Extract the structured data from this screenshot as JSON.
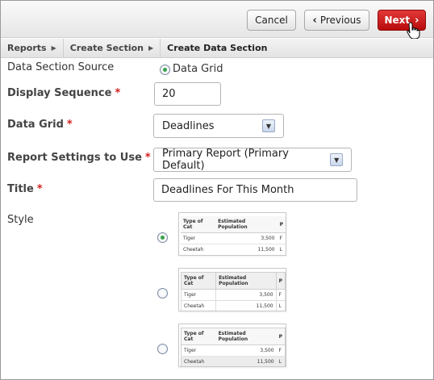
{
  "toolbar": {
    "cancel_label": "Cancel",
    "previous_label": "Previous",
    "next_label": "Next"
  },
  "breadcrumb": [
    "Reports",
    "Create Section",
    "Create Data Section"
  ],
  "form": {
    "data_section_source": {
      "label": "Data Section Source",
      "option": "Data Grid"
    },
    "display_sequence": {
      "label": "Display Sequence",
      "value": "20"
    },
    "data_grid": {
      "label": "Data Grid",
      "value": "Deadlines"
    },
    "report_settings": {
      "label": "Report Settings to Use",
      "value": "Primary Report (Primary Default)"
    },
    "title": {
      "label": "Title",
      "value": "Deadlines For This Month"
    },
    "style": {
      "label": "Style"
    }
  },
  "required_marker": "*",
  "style_thumbnail": {
    "headers": [
      "Type of Cat",
      "Estimated Population",
      "P"
    ],
    "rows": [
      [
        "Tiger",
        "3,500",
        "F"
      ],
      [
        "Cheetah",
        "11,500",
        "L"
      ]
    ]
  },
  "colors": {
    "next_button": "#c81a1a",
    "required": "#d42020",
    "radio_checked": "#38a24a"
  }
}
